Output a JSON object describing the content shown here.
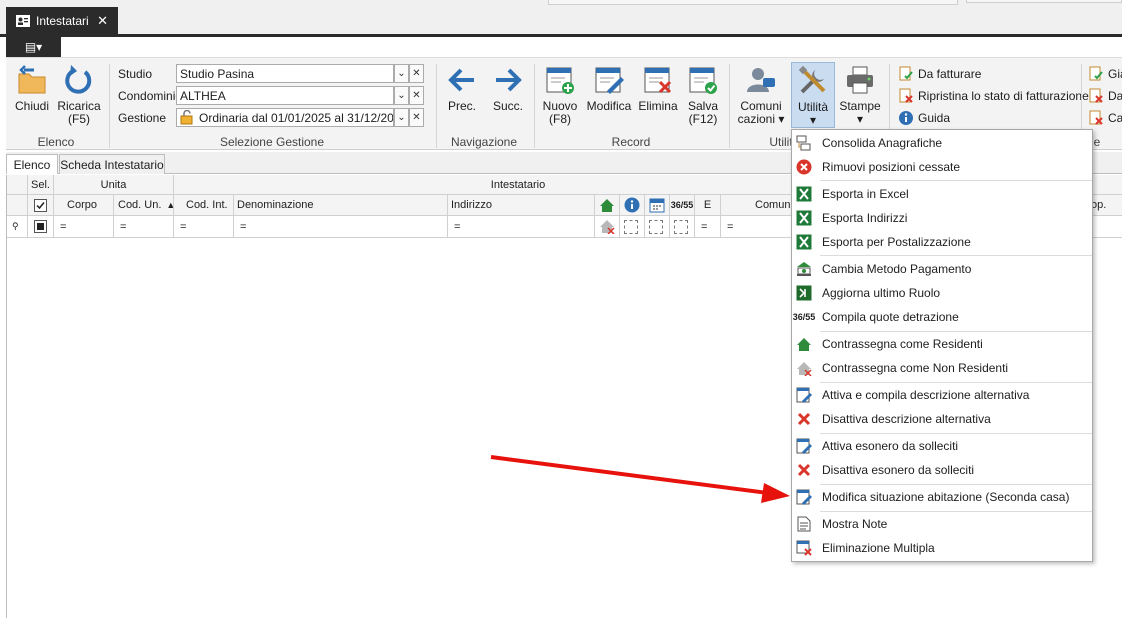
{
  "window": {
    "tab_title": "Intestatari",
    "close": "✕",
    "app_menu": "▤▾"
  },
  "ribbon": {
    "elenco": {
      "group": "Elenco",
      "chiudi": "Chiudi",
      "ricarica": "Ricarica",
      "ricarica_key": "(F5)"
    },
    "selezione": {
      "group": "Selezione Gestione",
      "studio_label": "Studio",
      "studio_value": "Studio Pasina",
      "condominio_label": "Condominio",
      "condominio_value": "ALTHEA",
      "gestione_label": "Gestione",
      "gestione_value": "Ordinaria dal 01/01/2025 al 31/12/20..."
    },
    "navigazione": {
      "group": "Navigazione",
      "prec": "Prec.",
      "succ": "Succ."
    },
    "record": {
      "group": "Record",
      "nuovo": "Nuovo",
      "nuovo_key": "(F8)",
      "modifica": "Modifica",
      "elimina": "Elimina",
      "salva": "Salva",
      "salva_key": "(F12)"
    },
    "utilita": {
      "group": "Utilit",
      "comunicazioni_1": "Comuni",
      "comunicazioni_2": "cazioni",
      "utilita": "Utilità",
      "stampe": "Stampe"
    },
    "right": {
      "da_fatturare": "Da fatturare",
      "ripristina": "Ripristina lo stato di fatturazione",
      "guida": "Guida",
      "gia": "Già",
      "da": "Da",
      "ca": "Ca",
      "group_tail": "e"
    }
  },
  "tabs": {
    "elenco": "Elenco",
    "scheda": "Scheda Intestatario"
  },
  "grid": {
    "band_sel": "Sel.",
    "band_unita": "Unita",
    "band_intestatario": "Intestatario",
    "col_corpo": "Corpo",
    "col_cod_un": "Cod. Un.",
    "col_cod_int": "Cod. Int.",
    "col_denominazione": "Denominazione",
    "col_indirizzo": "Indirizzo",
    "col_e": "E",
    "col_comuni": "Comuni",
    "col_op": "op.",
    "filter_eq": "=",
    "col_detr": "36/55"
  },
  "menu": {
    "items": [
      {
        "label": "Consolida Anagrafiche",
        "icon": "merge-icon"
      },
      {
        "label": "Rimuovi posizioni cessate",
        "icon": "remove-circle-icon"
      },
      {
        "label": "Esporta in Excel",
        "icon": "excel-icon"
      },
      {
        "label": "Esporta Indirizzi",
        "icon": "excel-icon"
      },
      {
        "label": "Esporta per Postalizzazione",
        "icon": "excel-icon"
      },
      {
        "label": "Cambia Metodo Pagamento",
        "icon": "bank-icon"
      },
      {
        "label": "Aggiorna ultimo Ruolo",
        "icon": "ruolo-icon"
      },
      {
        "label": "Compila quote detrazione",
        "icon": "detrazione-icon"
      },
      {
        "label": "Contrassegna come Residenti",
        "icon": "home-icon"
      },
      {
        "label": "Contrassegna come Non Residenti",
        "icon": "home-remove-icon"
      },
      {
        "label": "Attiva e compila descrizione alternativa",
        "icon": "edit-doc-icon"
      },
      {
        "label": "Disattiva descrizione alternativa",
        "icon": "red-x-icon"
      },
      {
        "label": "Attiva esonero da solleciti",
        "icon": "edit-doc-icon"
      },
      {
        "label": "Disattiva esonero da solleciti",
        "icon": "red-x-icon"
      },
      {
        "label": "Modifica situazione abitazione (Seconda casa)",
        "icon": "edit-doc-icon"
      },
      {
        "label": "Mostra Note",
        "icon": "note-icon"
      },
      {
        "label": "Eliminazione Multipla",
        "icon": "delete-multiple-icon"
      }
    ]
  },
  "colors": {
    "accent_blue": "#2f6fb3",
    "excel_green": "#1f7a3a",
    "red": "#d9352b",
    "arrow_red": "#e8120c",
    "active_button": "#c9dcf0"
  }
}
